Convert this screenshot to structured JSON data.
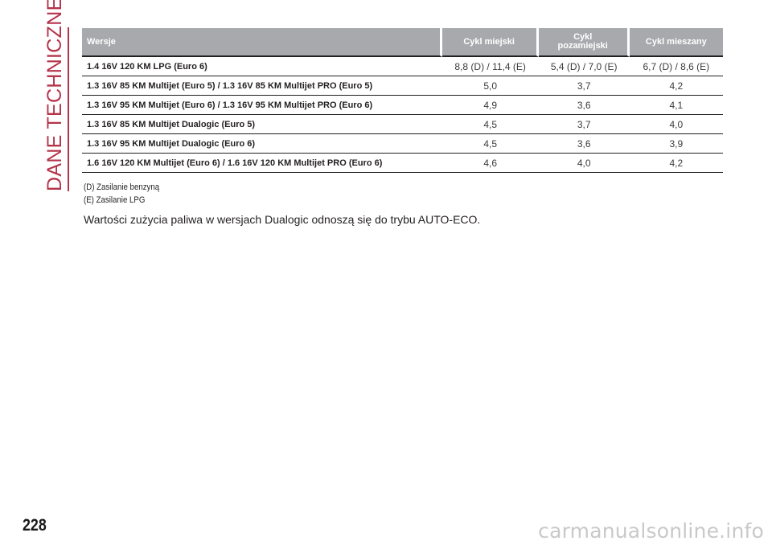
{
  "side": {
    "section_title": "DANE TECHNICZNE"
  },
  "page": {
    "number": "228"
  },
  "table": {
    "headers": {
      "version": "Wersje",
      "urban": "Cykl miejski",
      "extra_urban_line1": "Cykl",
      "extra_urban_line2": "pozamiejski",
      "combined": "Cykl mieszany"
    },
    "rows": [
      {
        "version": "1.4 16V 120 KM LPG (Euro 6)",
        "urban": "8,8 (D) / 11,4 (E)",
        "extra_urban": "5,4 (D) / 7,0 (E)",
        "combined": "6,7 (D) / 8,6 (E)"
      },
      {
        "version": "1.3 16V 85 KM Multijet (Euro 5) / 1.3 16V 85 KM Multijet PRO (Euro 5)",
        "urban": "5,0",
        "extra_urban": "3,7",
        "combined": "4,2"
      },
      {
        "version": "1.3 16V 95 KM Multijet (Euro 6) / 1.3 16V 95 KM Multijet PRO (Euro 6)",
        "urban": "4,9",
        "extra_urban": "3,6",
        "combined": "4,1"
      },
      {
        "version": "1.3 16V 85 KM Multijet Dualogic (Euro 5)",
        "urban": "4,5",
        "extra_urban": "3,7",
        "combined": "4,0"
      },
      {
        "version": "1.3 16V 95 KM Multijet Dualogic (Euro 6)",
        "urban": "4,5",
        "extra_urban": "3,6",
        "combined": "3,9"
      },
      {
        "version": "1.6 16V 120 KM Multijet (Euro 6) / 1.6 16V 120 KM Multijet PRO (Euro 6)",
        "urban": "4,6",
        "extra_urban": "4,0",
        "combined": "4,2"
      }
    ]
  },
  "footnotes": {
    "d": "(D) Zasilanie benzyną",
    "e": "(E) Zasilanie LPG"
  },
  "note": "Wartości zużycia paliwa w wersjach Dualogic odnoszą się do trybu AUTO-ECO.",
  "watermark": "carmanualsonline.info",
  "colors": {
    "accent": "#b5344a",
    "header_bg": "#a7a9ac"
  }
}
